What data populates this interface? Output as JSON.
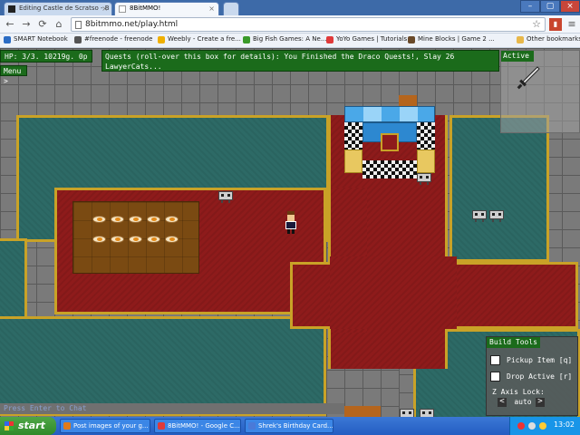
{
  "browser": {
    "tabs": [
      {
        "title": "Editing Castle de Scratso - B"
      },
      {
        "title": "8BitMMO!"
      }
    ],
    "url": "8bitmmo.net/play.html",
    "bookmarks": [
      {
        "label": "SMART Notebook",
        "color": "#2b6cc4"
      },
      {
        "label": "#freenode - freenode",
        "color": "#555555"
      },
      {
        "label": "Weebly - Create a fre...",
        "color": "#f0b000"
      },
      {
        "label": "Big Fish Games: A Ne...",
        "color": "#3a9a2a"
      },
      {
        "label": "YoYo Games | Tutorials",
        "color": "#e03a3a"
      },
      {
        "label": "Mine Blocks | Game 2 ...",
        "color": "#6a4a2a"
      },
      {
        "label": "Other bookmarks",
        "color": "#e8b84a"
      }
    ]
  },
  "game": {
    "hud_status": "HP: 3/3. 10219g. 0p",
    "quests_text": "Quests (roll-over this box for details): You Finished the Draco Quests!, Slay 26 LawyerCats...",
    "menu_label": "Menu >",
    "active_label": "Active",
    "active_item": "sword-icon",
    "build_tools": {
      "title": "Build Tools",
      "pickup_label": "Pickup Item [q]",
      "drop_label": "Drop Active [r]",
      "zaxis_label": "Z Axis Lock:",
      "zaxis_prev": "<",
      "zaxis_value": "auto",
      "zaxis_next": ">"
    },
    "chat_placeholder": "Press Enter to Chat",
    "colors": {
      "carpet": "#8e1b1b",
      "teal_floor": "#2d6a66",
      "gold_trim": "#c9a227",
      "stone": "#7a7a7a",
      "hud_green": "#1b6b1b"
    }
  },
  "taskbar": {
    "start_label": "start",
    "tasks": [
      {
        "label": "Post images of your g...",
        "color": "#e07a1a"
      },
      {
        "label": "8BitMMO! - Google C...",
        "color": "#e03a3a"
      },
      {
        "label": "Shrek's Birthday Card...",
        "color": "#4a7ad8"
      }
    ],
    "clock": "13:02"
  }
}
